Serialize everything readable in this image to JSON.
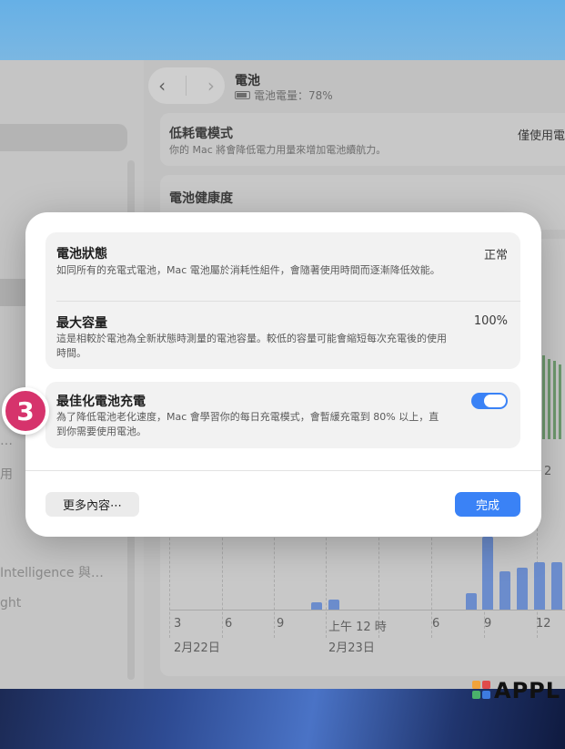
{
  "window": {
    "nav_back": "‹",
    "nav_forward": "›",
    "title": "電池",
    "subtitle": "電池電量：78%",
    "low_power": {
      "title": "低耗電模式",
      "desc": "你的 Mac 將會降低電力用量來增加電池續航力。",
      "value": "僅使用電"
    },
    "health_title": "電池健康度",
    "sidebar_items": [
      "Intelligence 與…",
      "ght"
    ],
    "sidebar_partial": [
      "用",
      "…"
    ],
    "chart": {
      "ticks": [
        "3",
        "6",
        "9",
        "上午 12 時",
        "6",
        "9",
        "12"
      ],
      "dates": [
        "2月22日",
        "2月23日"
      ],
      "side_label": "2"
    }
  },
  "modal": {
    "status": {
      "title": "電池狀態",
      "value": "正常",
      "desc": "如同所有的充電式電池，Mac 電池屬於消耗性組件，會隨著使用時間而逐漸降低效能。"
    },
    "capacity": {
      "title": "最大容量",
      "value": "100%",
      "desc": "這是相較於電池為全新狀態時測量的電池容量。較低的容量可能會縮短每次充電後的使用時間。"
    },
    "optimized": {
      "title": "最佳化電池充電",
      "desc": "為了降低電池老化速度，Mac 會學習你的每日充電模式，會暫緩充電到 80% 以上，直到你需要使用電池。",
      "enabled": true
    },
    "more_button": "更多內容⋯",
    "done_button": "完成"
  },
  "step_badge": "3",
  "watermark": "APPL",
  "colors": {
    "accent": "#3a82f6",
    "badge": "#d6336c"
  }
}
